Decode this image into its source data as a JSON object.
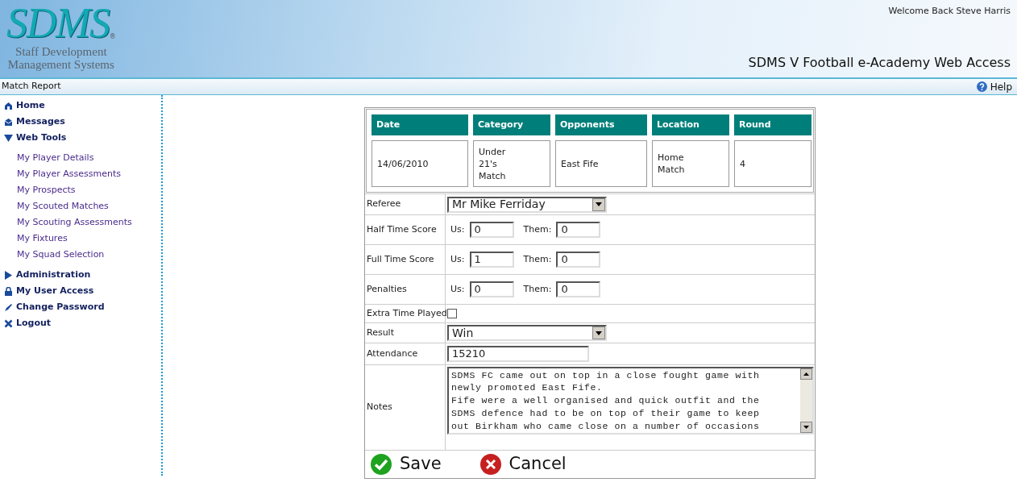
{
  "header": {
    "logo": "SDMS",
    "logo_mark": "®",
    "logo_subtitle": [
      "Staff Development",
      "Management Systems"
    ],
    "welcome": "Welcome Back Steve Harris",
    "site_title": "SDMS V Football e-Academy Web Access"
  },
  "page_bar": {
    "title": "Match Report",
    "help": "Help"
  },
  "sidebar": {
    "items": [
      {
        "label": "Home",
        "kind": "home"
      },
      {
        "label": "Messages",
        "kind": "messages"
      },
      {
        "label": "Web Tools",
        "kind": "group",
        "expanded": true,
        "children": [
          {
            "label": "My Player Details"
          },
          {
            "label": "My Player Assessments"
          },
          {
            "label": "My Prospects"
          },
          {
            "label": "My Scouted Matches"
          },
          {
            "label": "My Scouting Assessments"
          },
          {
            "label": "My Fixtures"
          },
          {
            "label": "My Squad Selection"
          }
        ]
      },
      {
        "label": "Administration",
        "kind": "group",
        "expanded": false
      },
      {
        "label": "My User Access",
        "kind": "lock"
      },
      {
        "label": "Change Password",
        "kind": "pen"
      },
      {
        "label": "Logout",
        "kind": "logout"
      }
    ]
  },
  "match": {
    "columns": [
      "Date",
      "Category",
      "Opponents",
      "Location",
      "Round"
    ],
    "values": [
      [
        "14/06/2010"
      ],
      [
        "Under",
        "21's",
        "Match"
      ],
      [
        "East Fife"
      ],
      [
        "Home",
        "Match"
      ],
      [
        "4"
      ]
    ]
  },
  "form": {
    "referee": {
      "label": "Referee",
      "value": "Mr Mike Ferriday"
    },
    "scores": [
      {
        "label": "Half Time Score",
        "us_label": "Us:",
        "us": "0",
        "them_label": "Them:",
        "them": "0"
      },
      {
        "label": "Full Time Score",
        "us_label": "Us:",
        "us": "1",
        "them_label": "Them:",
        "them": "0"
      },
      {
        "label": "Penalties",
        "us_label": "Us:",
        "us": "0",
        "them_label": "Them:",
        "them": "0"
      }
    ],
    "extra_time": {
      "label": "Extra Time Played",
      "checked": false
    },
    "result": {
      "label": "Result",
      "value": "Win"
    },
    "attendance": {
      "label": "Attendance",
      "value": "15210"
    },
    "notes": {
      "label": "Notes",
      "lines": [
        "SDMS FC came out on top in a close fought game with",
        "newly promoted East Fife.",
        "Fife were a well organised and quick outfit and the",
        "SDMS defence had to be on top of their game to keep",
        "out Birkham who came close on a number of occasions"
      ]
    }
  },
  "buttons": {
    "save": "Save",
    "cancel": "Cancel"
  }
}
